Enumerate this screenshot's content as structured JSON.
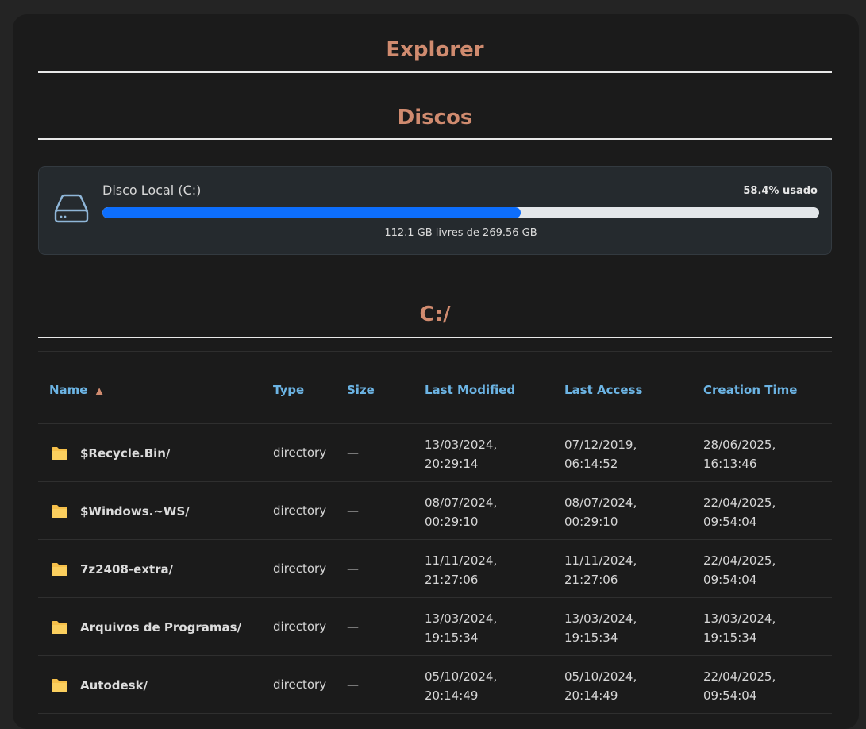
{
  "header": {
    "title": "Explorer"
  },
  "disks_section": {
    "title": "Discos"
  },
  "disk": {
    "name": "Disco Local (C:)",
    "used_label": "58.4% usado",
    "used_fraction": 0.584,
    "free_label": "112.1 GB livres de 269.56 GB",
    "bar_color": "#0d6efd",
    "icon": "hard-drive-icon"
  },
  "path_section": {
    "title": "C:/"
  },
  "table": {
    "columns": [
      "Name",
      "Type",
      "Size",
      "Last Modified",
      "Last Access",
      "Creation Time"
    ],
    "sort_indicator": "▲",
    "rows": [
      {
        "name": "$Recycle.Bin/",
        "type": "directory",
        "size": "—",
        "modified": [
          "13/03/2024,",
          "20:29:14"
        ],
        "access": [
          "07/12/2019,",
          "06:14:52"
        ],
        "created": [
          "28/06/2025,",
          "16:13:46"
        ]
      },
      {
        "name": "$Windows.~WS/",
        "type": "directory",
        "size": "—",
        "modified": [
          "08/07/2024,",
          "00:29:10"
        ],
        "access": [
          "08/07/2024,",
          "00:29:10"
        ],
        "created": [
          "22/04/2025,",
          "09:54:04"
        ]
      },
      {
        "name": "7z2408-extra/",
        "type": "directory",
        "size": "—",
        "modified": [
          "11/11/2024,",
          "21:27:06"
        ],
        "access": [
          "11/11/2024,",
          "21:27:06"
        ],
        "created": [
          "22/04/2025,",
          "09:54:04"
        ]
      },
      {
        "name": "Arquivos de Programas/",
        "type": "directory",
        "size": "—",
        "modified": [
          "13/03/2024,",
          "19:15:34"
        ],
        "access": [
          "13/03/2024,",
          "19:15:34"
        ],
        "created": [
          "13/03/2024,",
          "19:15:34"
        ]
      },
      {
        "name": "Autodesk/",
        "type": "directory",
        "size": "—",
        "modified": [
          "05/10/2024,",
          "20:14:49"
        ],
        "access": [
          "05/10/2024,",
          "20:14:49"
        ],
        "created": [
          "22/04/2025,",
          "09:54:04"
        ]
      }
    ]
  },
  "colors": {
    "accent_title": "#d08b6f",
    "header_link": "#6cb4e4",
    "folder": "#f6c04a"
  }
}
